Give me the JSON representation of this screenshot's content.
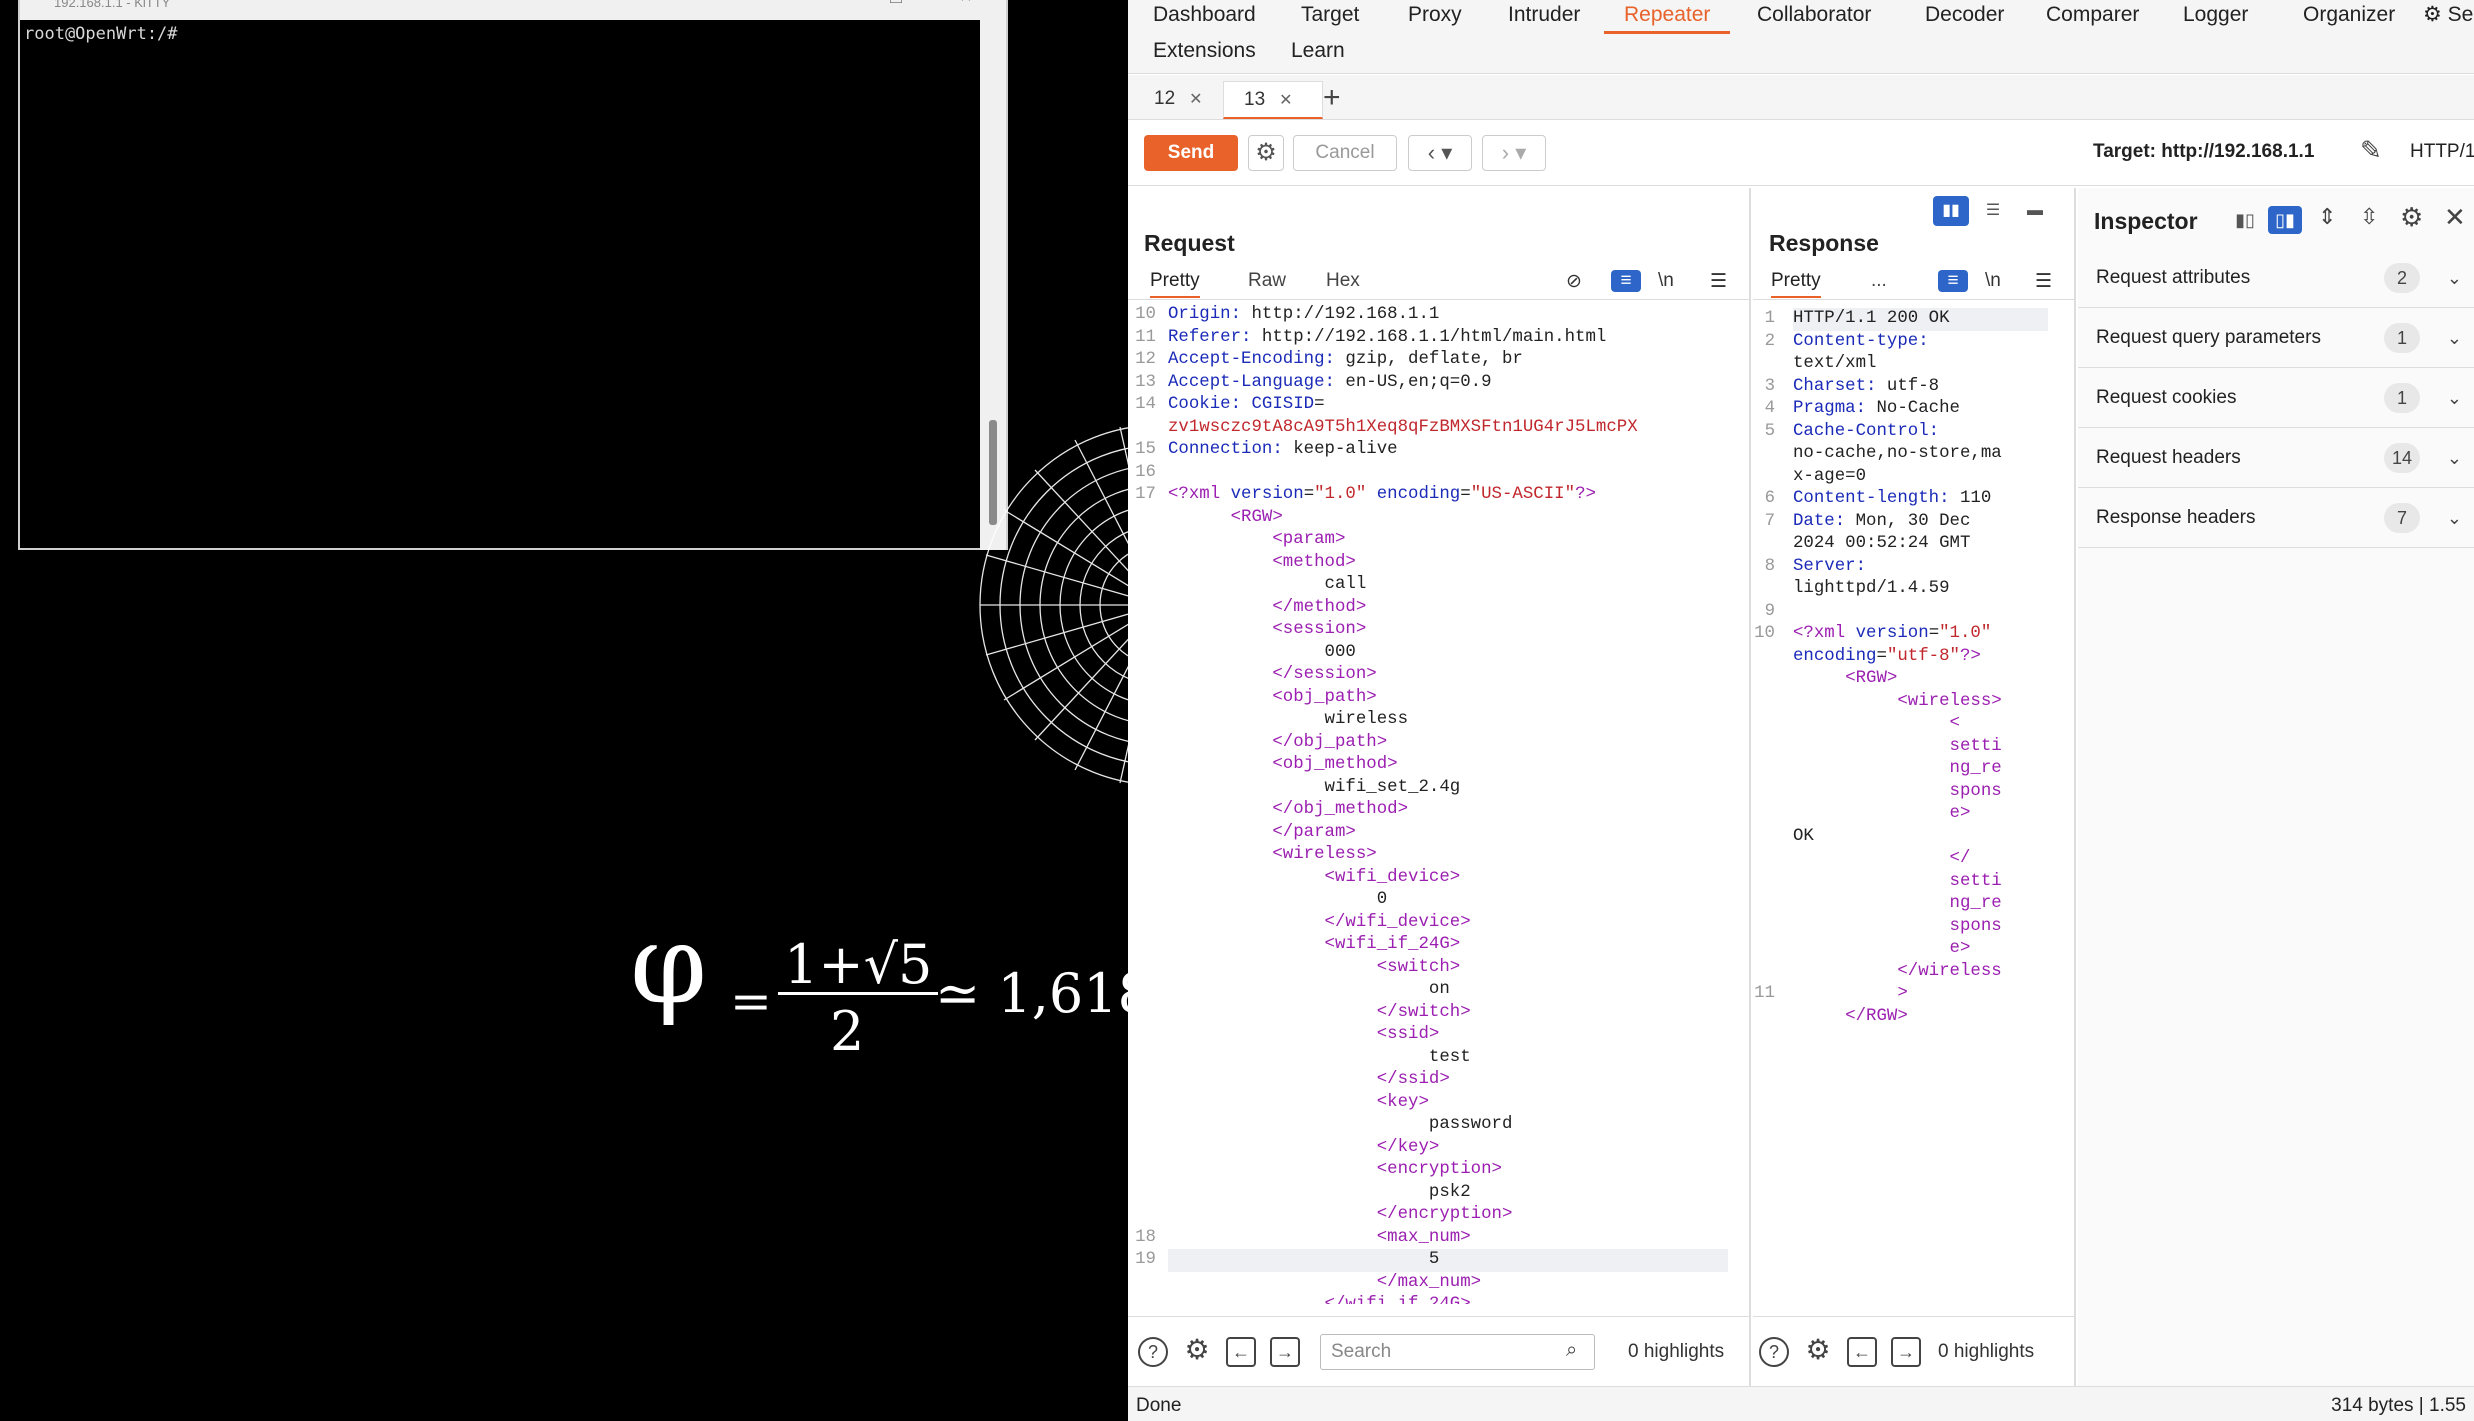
{
  "terminal": {
    "title": "192.168.1.1 - KiTTY",
    "prompt": "root@OpenWrt:/#"
  },
  "wallpaper": {
    "phi": "φ",
    "eq": "=",
    "numerator": "1+√5",
    "denominator": "2",
    "approx": "≃ 1,618"
  },
  "burp": {
    "nav_tabs": [
      "Dashboard",
      "Target",
      "Proxy",
      "Intruder",
      "Repeater",
      "Collaborator",
      "Decoder",
      "Comparer",
      "Logger",
      "Organizer",
      "Se"
    ],
    "nav_tabs_row2": [
      "Extensions",
      "Learn"
    ],
    "active_tab": "Repeater",
    "repeater_tabs": [
      {
        "label": "12"
      },
      {
        "label": "13"
      }
    ],
    "toolbar": {
      "send": "Send",
      "cancel": "Cancel",
      "target": "Target: http://192.168.1.1",
      "http": "HTTP/1"
    },
    "request": {
      "title": "Request",
      "views": [
        "Pretty",
        "Raw",
        "Hex"
      ],
      "newline_label": "\\n",
      "search_placeholder": "Search",
      "highlights": "0 highlights"
    },
    "response": {
      "title": "Response",
      "views": [
        "Pretty",
        "..."
      ],
      "newline_label": "\\n",
      "highlights": "0 highlights"
    },
    "inspector": {
      "title": "Inspector",
      "rows": [
        {
          "label": "Request attributes",
          "count": "2"
        },
        {
          "label": "Request query parameters",
          "count": "1"
        },
        {
          "label": "Request cookies",
          "count": "1"
        },
        {
          "label": "Request headers",
          "count": "14"
        },
        {
          "label": "Response headers",
          "count": "7"
        }
      ]
    },
    "status": {
      "left": "Done",
      "right": "314 bytes | 1.55"
    }
  }
}
